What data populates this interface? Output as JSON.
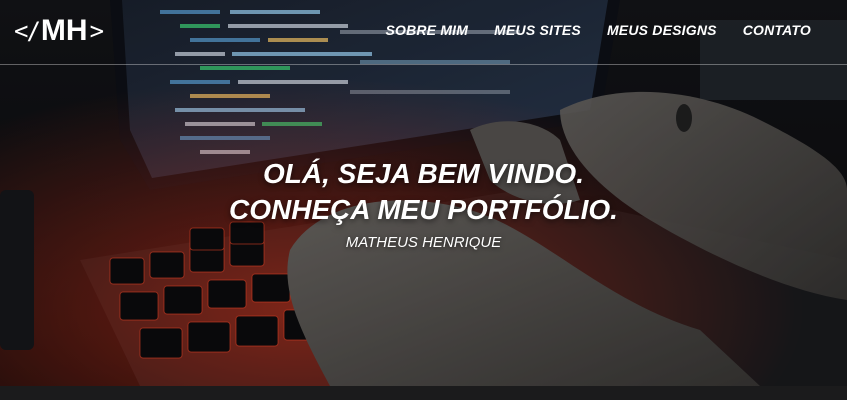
{
  "logo": {
    "left": "<",
    "slash": "/",
    "text": "MH",
    "right": ">"
  },
  "nav": {
    "items": [
      {
        "label": "SOBRE MIM"
      },
      {
        "label": "MEUS SITES"
      },
      {
        "label": "MEUS DESIGNS"
      },
      {
        "label": "CONTATO"
      }
    ]
  },
  "hero": {
    "line1": "OLÁ, SEJA BEM VINDO.",
    "line2": "CONHEÇA MEU PORTFÓLIO.",
    "subtitle": "MATHEUS HENRIQUE"
  },
  "colors": {
    "text": "#ffffff",
    "keyboard_backlight": "#ff3b1f",
    "screen_code": "#3fd17a",
    "dark_bg": "#111111"
  }
}
